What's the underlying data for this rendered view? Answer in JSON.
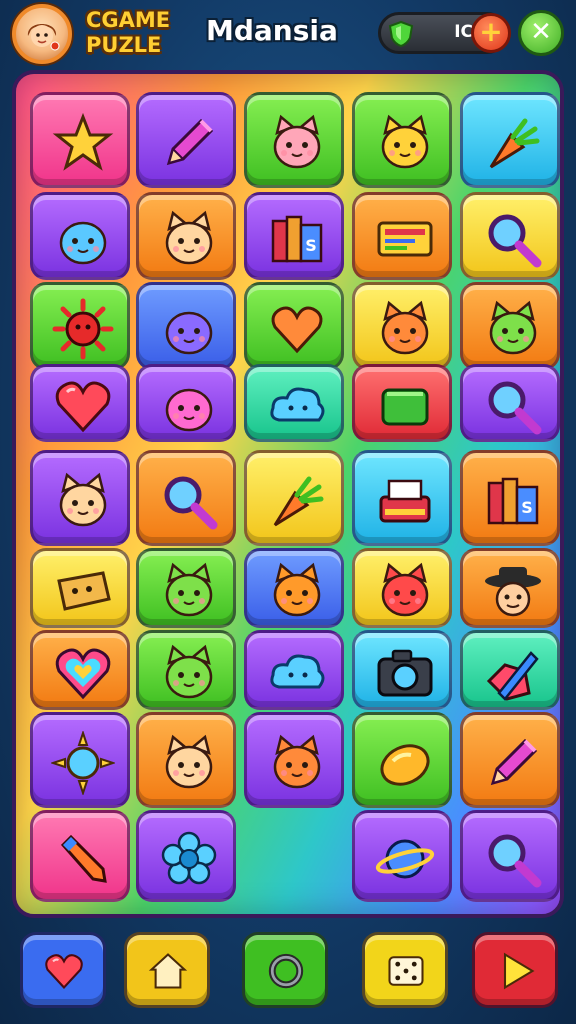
{
  "header": {
    "logo_line1": "CGAME",
    "logo_line2": "PUZLE",
    "title": "Mdansia",
    "currency_value": "IC",
    "plus_label": "+",
    "close_label": "✕",
    "avatar_icon": "girl-avatar-icon",
    "gem_icon": "green-shield-gem-icon"
  },
  "board": {
    "tiles": [
      {
        "icon": "star-icon",
        "color": "pink"
      },
      {
        "icon": "pencil-icon",
        "color": "purple"
      },
      {
        "icon": "pig-face-icon",
        "color": "green"
      },
      {
        "icon": "yellow-cat-icon",
        "color": "green"
      },
      {
        "icon": "carrot-icon",
        "color": "cyan"
      },
      {
        "icon": "blue-blob-icon",
        "color": "purple"
      },
      {
        "icon": "cat-face-icon",
        "color": "orange"
      },
      {
        "icon": "books-icon",
        "color": "purple"
      },
      {
        "icon": "ticket-icon",
        "color": "orange"
      },
      {
        "icon": "magnifier-icon",
        "color": "yellow"
      },
      {
        "icon": "red-sun-icon",
        "color": "green"
      },
      {
        "icon": "purple-blob-icon",
        "color": "blue"
      },
      {
        "icon": "heart-speech-icon",
        "color": "green"
      },
      {
        "icon": "orange-cat-icon",
        "color": "yellow"
      },
      {
        "icon": "green-cat-icon",
        "color": "orange"
      },
      {
        "icon": "heart-icon",
        "color": "purple"
      },
      {
        "icon": "pink-ball-icon",
        "color": "purple"
      },
      {
        "icon": "blue-cloud-icon",
        "color": "teal"
      },
      {
        "icon": "green-gem-icon",
        "color": "red"
      },
      {
        "icon": "magnifier-icon",
        "color": "purple"
      },
      {
        "icon": "cat-face-icon",
        "color": "purple"
      },
      {
        "icon": "magnifier-icon",
        "color": "orange"
      },
      {
        "icon": "carrot-icon",
        "color": "yellow"
      },
      {
        "icon": "typewriter-icon",
        "color": "cyan"
      },
      {
        "icon": "books-icon",
        "color": "orange"
      },
      {
        "icon": "cheese-icon",
        "color": "yellow"
      },
      {
        "icon": "green-cat-icon",
        "color": "green"
      },
      {
        "icon": "orange-fox-icon",
        "color": "blue"
      },
      {
        "icon": "red-cat-icon",
        "color": "yellow"
      },
      {
        "icon": "hat-face-icon",
        "color": "orange"
      },
      {
        "icon": "rainbow-heart-icon",
        "color": "orange"
      },
      {
        "icon": "green-cat-icon",
        "color": "green"
      },
      {
        "icon": "blue-cloud-icon",
        "color": "purple"
      },
      {
        "icon": "camera-icon",
        "color": "cyan"
      },
      {
        "icon": "pen-gem-icon",
        "color": "teal"
      },
      {
        "icon": "sun-icon",
        "color": "purple"
      },
      {
        "icon": "cat-face-icon",
        "color": "orange"
      },
      {
        "icon": "orange-cat-icon",
        "color": "purple"
      },
      {
        "icon": "lemon-icon",
        "color": "green"
      },
      {
        "icon": "pencil-icon",
        "color": "orange"
      },
      {
        "icon": "crayon-icon",
        "color": "pink"
      },
      {
        "icon": "flower-icon",
        "color": "purple"
      },
      {
        "icon": "planet-icon",
        "color": "purple"
      },
      {
        "icon": "magnifier-icon",
        "color": "purple"
      }
    ]
  },
  "bottom_bar": [
    {
      "icon": "heart-icon",
      "color": "#3a6cf0"
    },
    {
      "icon": "home-icon",
      "color": "#f2c51a"
    },
    {
      "icon": "ring-icon",
      "color": "#3fbf22"
    },
    {
      "icon": "dice-icon",
      "color": "#f2d51a"
    },
    {
      "icon": "play-icon",
      "color": "#e02a36"
    }
  ],
  "colors": {
    "background": "#123a66",
    "logo_text": "#ffcf33",
    "title_text": "#ffffff"
  }
}
